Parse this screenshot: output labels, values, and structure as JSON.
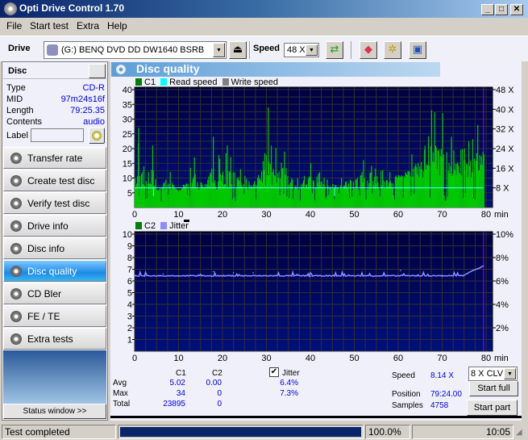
{
  "window": {
    "title": "Opti Drive Control 1.70",
    "minimize": "_",
    "maximize": "□",
    "close": "✕"
  },
  "menu": [
    "File",
    "Start test",
    "Extra",
    "Help"
  ],
  "toolbar": {
    "drive_label": "Drive",
    "drive_value": "(G:)   BENQ DVD DD DW1640 BSRB",
    "speed_label": "Speed",
    "speed_value": "48 X",
    "icons": [
      "eject-icon",
      "refresh-icon",
      "erase-icon",
      "settings-icon",
      "save-icon"
    ]
  },
  "disc": {
    "header": "Disc",
    "fields": [
      {
        "label": "Type",
        "value": "CD-R"
      },
      {
        "label": "MID",
        "value": "97m24s16f"
      },
      {
        "label": "Length",
        "value": "79:25.35"
      },
      {
        "label": "Contents",
        "value": "audio"
      }
    ],
    "label_label": "Label",
    "label_value": ""
  },
  "nav": [
    {
      "label": "Transfer rate",
      "active": false
    },
    {
      "label": "Create test disc",
      "active": false
    },
    {
      "label": "Verify test disc",
      "active": false
    },
    {
      "label": "Drive info",
      "active": false
    },
    {
      "label": "Disc info",
      "active": false
    },
    {
      "label": "Disc quality",
      "active": true
    },
    {
      "label": "CD Bler",
      "active": false
    },
    {
      "label": "FE / TE",
      "active": false
    },
    {
      "label": "Extra tests",
      "active": false
    }
  ],
  "status_window_button": "Status window >>",
  "section_title": "Disc quality",
  "chart_data": [
    {
      "type": "bar",
      "title": "C1 / Read speed",
      "legend": [
        {
          "name": "C1",
          "color": "#008000"
        },
        {
          "name": "Read speed",
          "color": "#00ffff"
        },
        {
          "name": "Write speed",
          "color": "#808080"
        }
      ],
      "xlabel": "min",
      "x_ticks": [
        "0",
        "10",
        "20",
        "30",
        "40",
        "50",
        "60",
        "70",
        "80"
      ],
      "xlim": [
        0,
        80
      ],
      "y_ticks": [
        "5",
        "10",
        "15",
        "20",
        "25",
        "30",
        "35",
        "40"
      ],
      "ylim": [
        0,
        40
      ],
      "y2_ticks": [
        "8 X",
        "16 X",
        "24 X",
        "32 X",
        "40 X",
        "48 X"
      ],
      "y2lim": [
        0,
        48
      ],
      "read_speed_x": 8.0,
      "end_marker_min": 79.4,
      "c1_series_profile": [
        {
          "x": 0,
          "y": 10
        },
        {
          "x": 0.8,
          "y": 27
        },
        {
          "x": 2,
          "y": 14
        },
        {
          "x": 4,
          "y": 21
        },
        {
          "x": 5,
          "y": 5
        },
        {
          "x": 8,
          "y": 12
        },
        {
          "x": 10,
          "y": 5
        },
        {
          "x": 13.5,
          "y": 17
        },
        {
          "x": 16,
          "y": 8
        },
        {
          "x": 17.8,
          "y": 24
        },
        {
          "x": 21,
          "y": 21
        },
        {
          "x": 24,
          "y": 13
        },
        {
          "x": 27,
          "y": 8
        },
        {
          "x": 30.3,
          "y": 34
        },
        {
          "x": 31,
          "y": 21
        },
        {
          "x": 34,
          "y": 19
        },
        {
          "x": 37,
          "y": 10
        },
        {
          "x": 40,
          "y": 15
        },
        {
          "x": 42,
          "y": 12
        },
        {
          "x": 45,
          "y": 8
        },
        {
          "x": 52,
          "y": 16
        },
        {
          "x": 58,
          "y": 12
        },
        {
          "x": 60,
          "y": 11
        },
        {
          "x": 63,
          "y": 18
        },
        {
          "x": 66,
          "y": 21
        },
        {
          "x": 67.5,
          "y": 33
        },
        {
          "x": 70,
          "y": 32
        },
        {
          "x": 72,
          "y": 24
        },
        {
          "x": 75,
          "y": 20
        },
        {
          "x": 78,
          "y": 28
        },
        {
          "x": 79.4,
          "y": 18
        }
      ]
    },
    {
      "type": "line",
      "title": "C2 / Jitter",
      "legend": [
        {
          "name": "C2",
          "color": "#008000"
        },
        {
          "name": "Jitter",
          "color": "#8888ff"
        }
      ],
      "xlabel": "min",
      "x_ticks": [
        "0",
        "10",
        "20",
        "30",
        "40",
        "50",
        "60",
        "70",
        "80"
      ],
      "xlim": [
        0,
        80
      ],
      "y_ticks": [
        "1",
        "2",
        "3",
        "4",
        "5",
        "6",
        "7",
        "8",
        "9",
        "10"
      ],
      "ylim": [
        0,
        10
      ],
      "y2_ticks": [
        "2%",
        "4%",
        "6%",
        "8%",
        "10%"
      ],
      "y2lim": [
        0,
        10
      ],
      "c2_values": "all 0",
      "jitter_profile": [
        {
          "x": 0,
          "y": 6.4
        },
        {
          "x": 6.5,
          "y": 6.6
        },
        {
          "x": 18,
          "y": 6.8
        },
        {
          "x": 22.5,
          "y": 6.7
        },
        {
          "x": 27,
          "y": 6.7
        },
        {
          "x": 40,
          "y": 6.4
        },
        {
          "x": 60.5,
          "y": 6.9
        },
        {
          "x": 70,
          "y": 6.4
        },
        {
          "x": 75,
          "y": 6.5
        },
        {
          "x": 77,
          "y": 6.9
        },
        {
          "x": 78.5,
          "y": 7.1
        },
        {
          "x": 79.4,
          "y": 7.3
        }
      ],
      "end_marker_min": 79.4
    }
  ],
  "stats": {
    "col_c1": "C1",
    "col_c2": "C2",
    "rows": [
      {
        "label": "Avg",
        "c1": "5.02",
        "c2": "0.00",
        "jitter": "6.4%"
      },
      {
        "label": "Max",
        "c1": "34",
        "c2": "0",
        "jitter": "7.3%"
      },
      {
        "label": "Total",
        "c1": "23895",
        "c2": "0",
        "jitter": ""
      }
    ],
    "jitter_label": "Jitter",
    "jitter_checked": true
  },
  "info": {
    "speed_label": "Speed",
    "speed_value": "8.14 X",
    "position_label": "Position",
    "position_value": "79:24.00",
    "samples_label": "Samples",
    "samples_value": "4758",
    "speed_mode": "8 X CLV",
    "start_full": "Start full",
    "start_part": "Start part"
  },
  "statusbar": {
    "message": "Test completed",
    "progress": 1.0,
    "progress_text": "100.0%",
    "time": "10:05"
  },
  "colors": {
    "c1": "#00c800",
    "read_speed": "#40ffff",
    "jitter": "#8c8cff",
    "marker": "#b000b0",
    "accent": "#1a8ae6"
  }
}
